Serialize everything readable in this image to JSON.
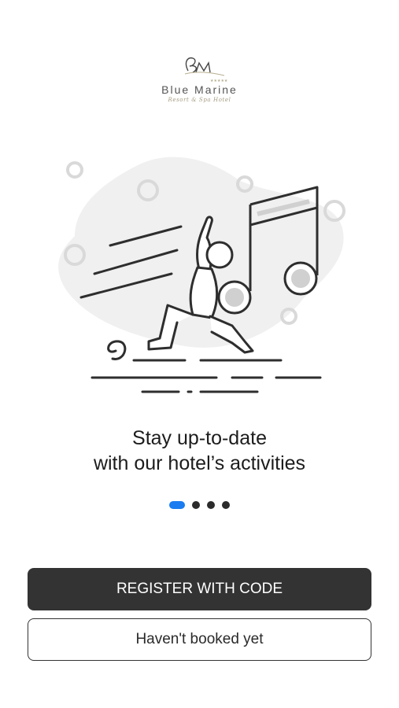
{
  "brand": {
    "name": "Blue Marine",
    "tagline": "Resort & Spa Hotel",
    "monogram": "BM",
    "stars": "★★★★★"
  },
  "onboarding": {
    "headline_line1": "Stay up-to-date",
    "headline_line2": "with our hotel’s activities",
    "illustration": "dancer-music-note-illustration",
    "pager": {
      "total": 4,
      "current": 1
    }
  },
  "actions": {
    "register_label": "REGISTER WITH CODE",
    "not_booked_label": "Haven't booked yet"
  },
  "colors": {
    "accent": "#1a7cf0",
    "primary_button": "#333333",
    "blob": "#f0f0f0",
    "line": "#2e2e2e"
  }
}
